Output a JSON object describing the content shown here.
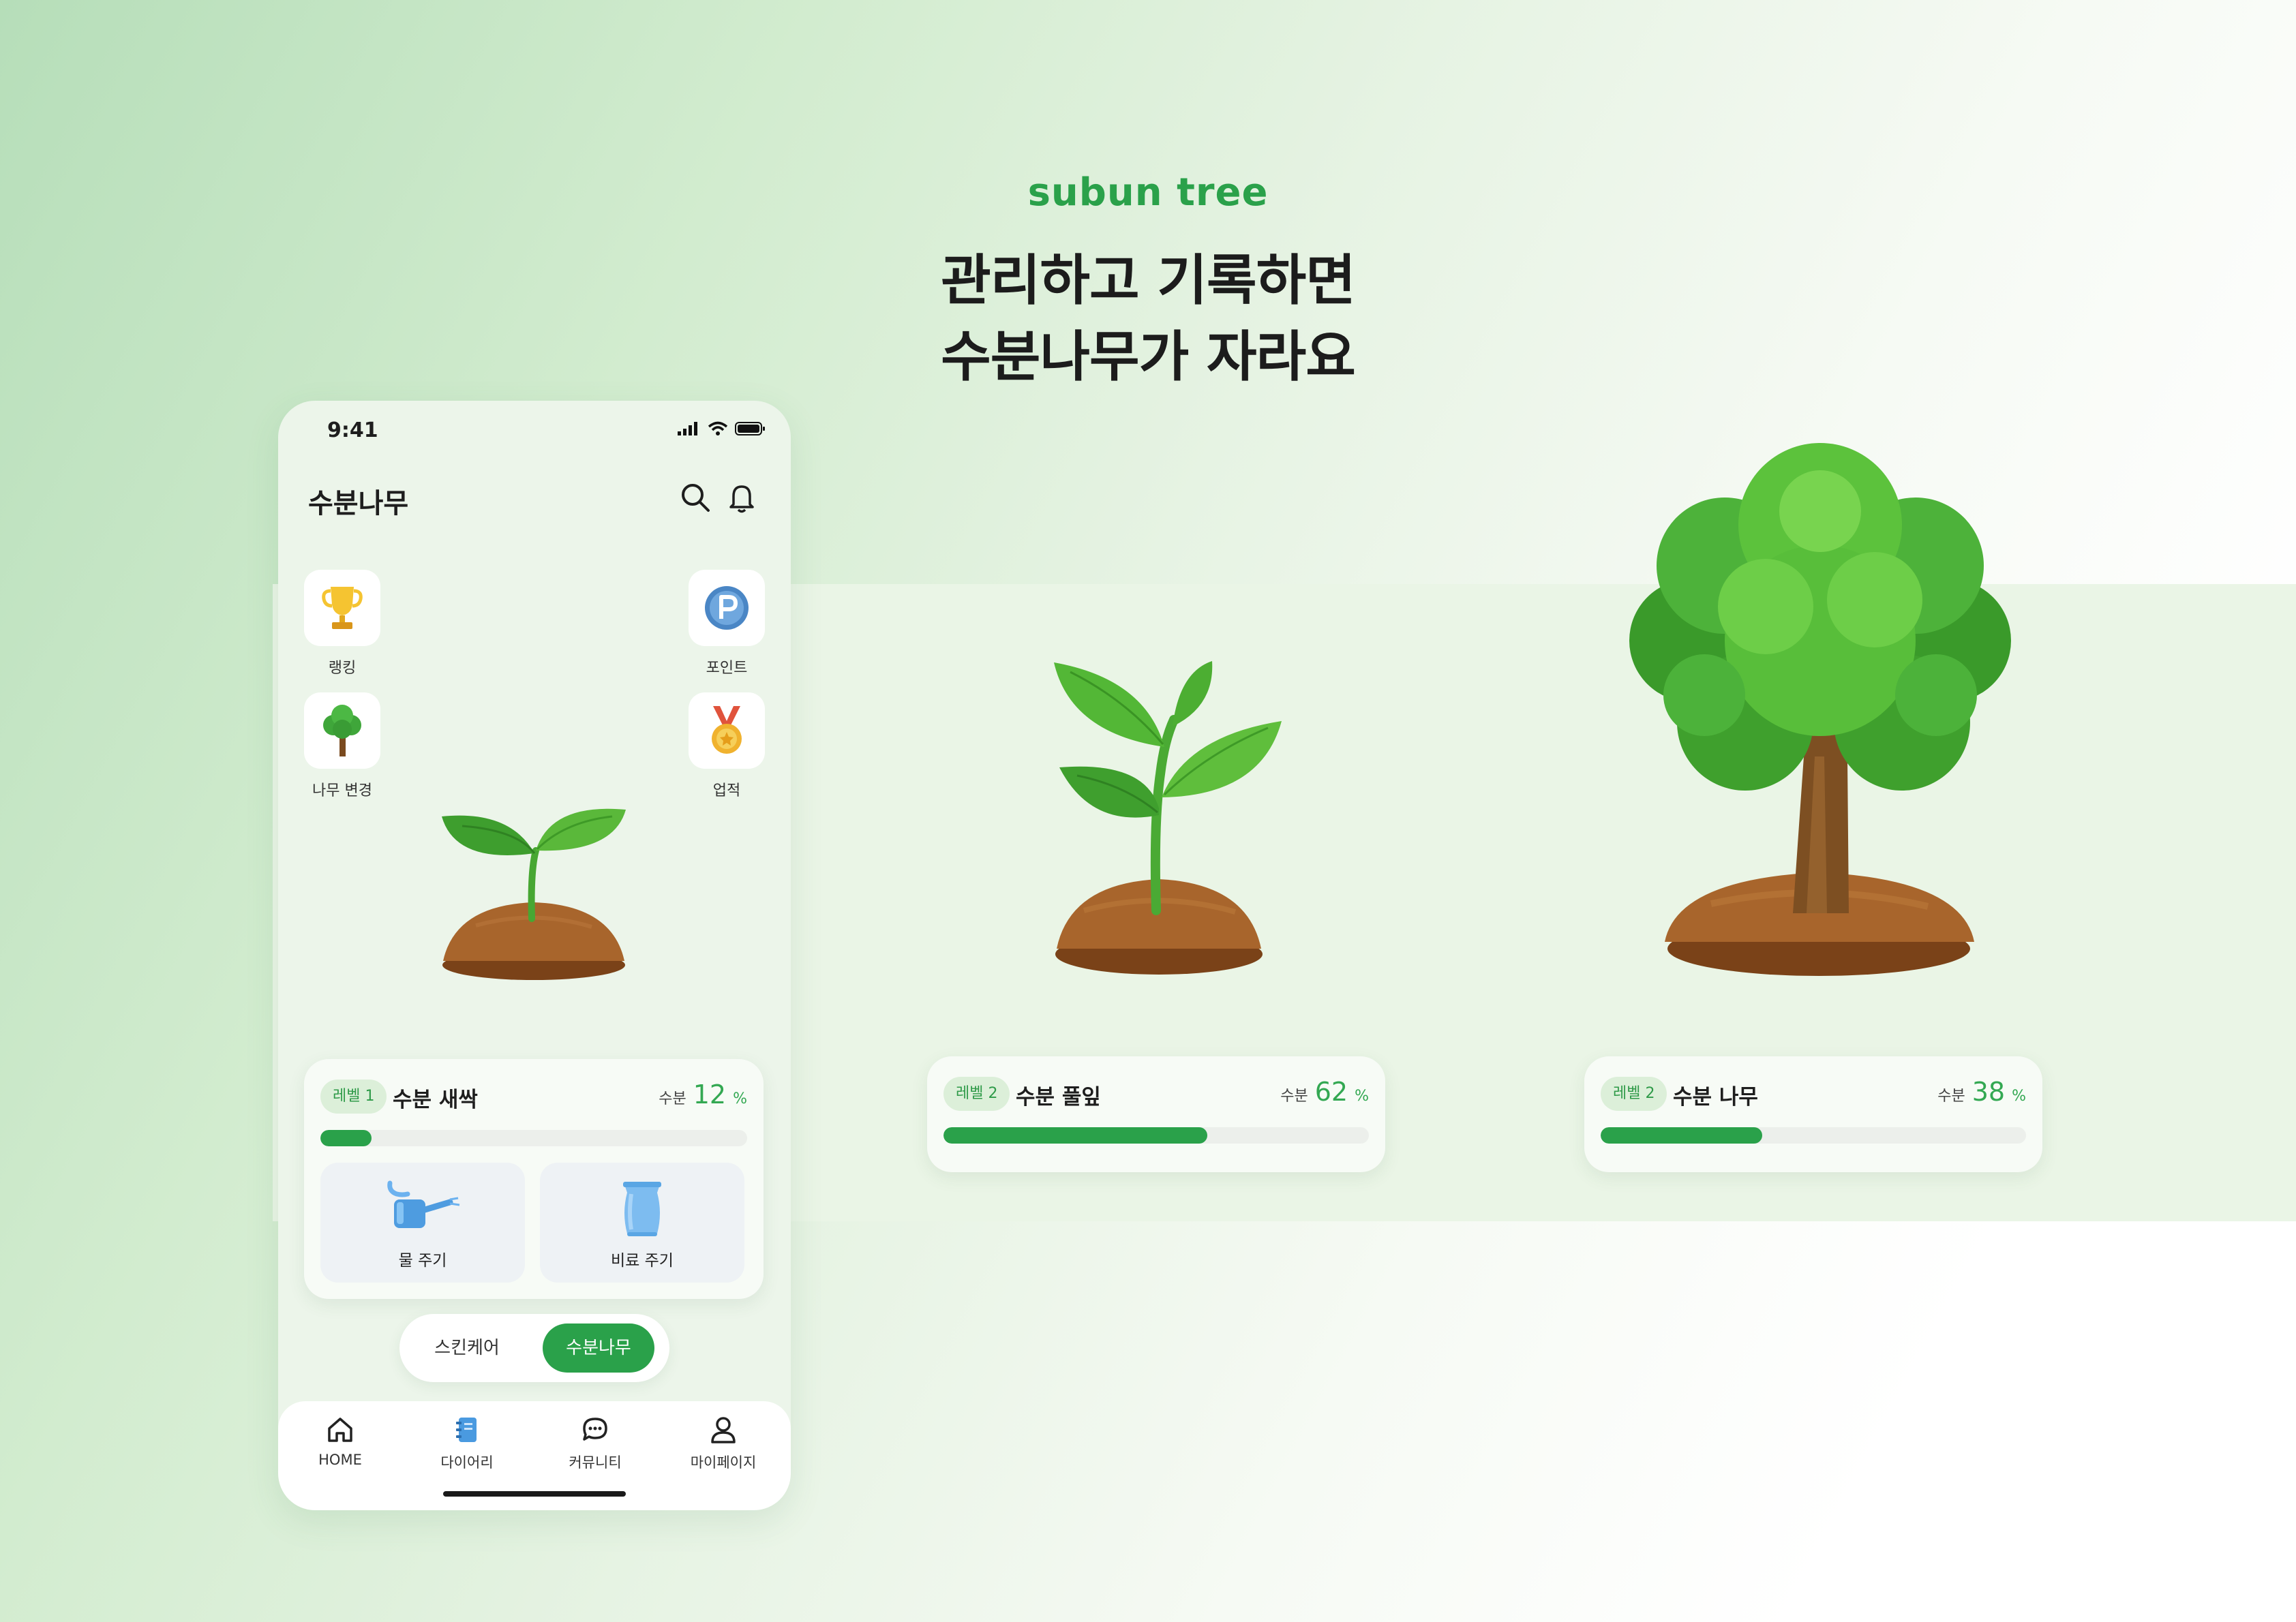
{
  "brand": "subun tree",
  "headline": {
    "line1": "관리하고 기록하면",
    "line2": "수분나무가 자라요"
  },
  "phone": {
    "status_time": "9:41",
    "app_title": "수분나무",
    "icons": {
      "search": "search-icon",
      "bell": "bell-icon"
    },
    "shortcuts": {
      "ranking": "랭킹",
      "points": "포인트",
      "tree_change": "나무 변경",
      "achievements": "업적"
    },
    "status_card": {
      "level": "레벨 1",
      "name": "수분 새싹",
      "moisture_label": "수분",
      "moisture_value": "12",
      "unit": "%",
      "progress": 0.12
    },
    "actions": {
      "water": "물 주기",
      "fertilizer": "비료 주기"
    },
    "toggle": {
      "skincare": "스킨케어",
      "tree": "수분나무",
      "selected": "수분나무"
    },
    "tabs": {
      "home": "HOME",
      "diary": "다이어리",
      "community": "커뮤니티",
      "mypage": "마이페이지"
    }
  },
  "stages": [
    {
      "level": "레벨 2",
      "name": "수분 풀잎",
      "moisture_label": "수분",
      "moisture_value": "62",
      "unit": "%",
      "progress": 0.62
    },
    {
      "level": "레벨 2",
      "name": "수분 나무",
      "moisture_label": "수분",
      "moisture_value": "38",
      "unit": "%",
      "progress": 0.38
    }
  ],
  "colors": {
    "accent": "#2aa14a",
    "badge_bg": "#dcefd9",
    "soil": "#9a5a2b",
    "leaf": "#5cc23c"
  }
}
